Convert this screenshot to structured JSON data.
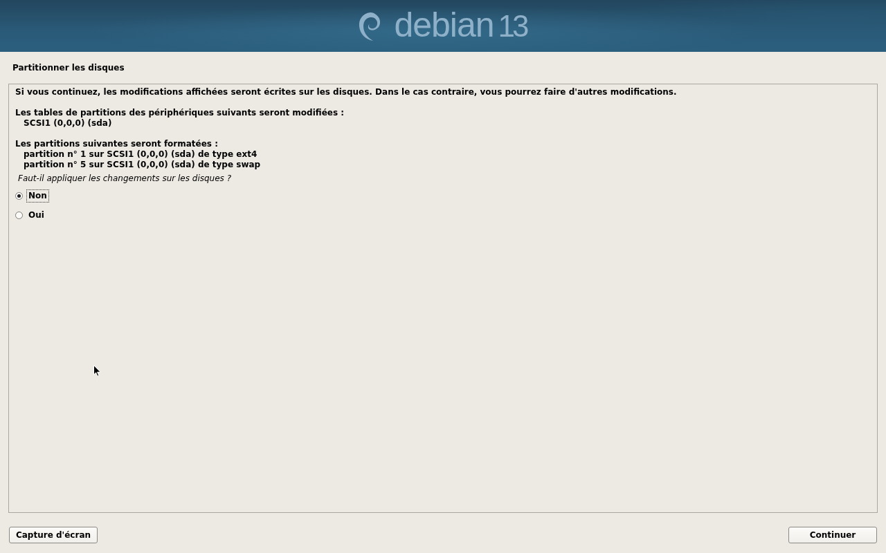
{
  "banner": {
    "logo_word": "debian",
    "logo_version": "13"
  },
  "page_title": "Partitionner les disques",
  "message": {
    "intro": "Si vous continuez, les modifications affichées seront écrites sur les disques. Dans le cas contraire, vous pourrez faire d'autres modifications.",
    "sections": [
      {
        "heading": "Les tables de partitions des périphériques suivants seront modifiées :",
        "items": [
          "SCSI1 (0,0,0) (sda)"
        ]
      },
      {
        "heading": "Les partitions suivantes seront formatées :",
        "items": [
          "partition n° 1 sur SCSI1 (0,0,0) (sda) de type ext4",
          "partition n° 5 sur SCSI1 (0,0,0) (sda) de type swap"
        ]
      }
    ],
    "question": "Faut-il appliquer les changements sur les disques ?"
  },
  "options": [
    {
      "label": "Non",
      "selected": true,
      "focused": true
    },
    {
      "label": "Oui",
      "selected": false,
      "focused": false
    }
  ],
  "footer": {
    "screenshot_button": "Capture d'écran",
    "continue_button": "Continuer"
  }
}
